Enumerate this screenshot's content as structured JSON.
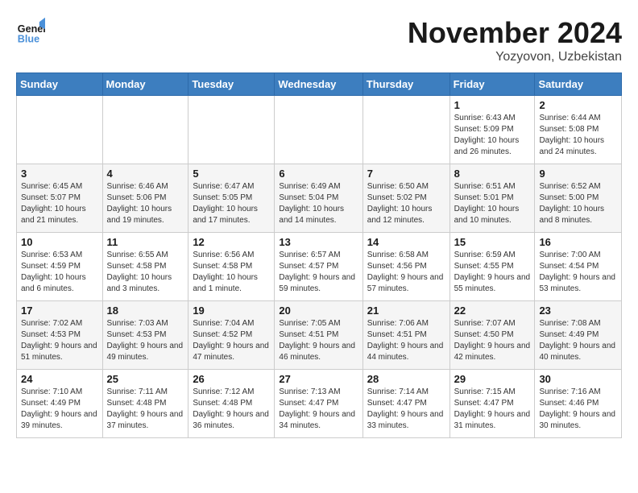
{
  "logo": {
    "line1": "General",
    "line2": "Blue"
  },
  "title": "November 2024",
  "location": "Yozyovon, Uzbekistan",
  "days_of_week": [
    "Sunday",
    "Monday",
    "Tuesday",
    "Wednesday",
    "Thursday",
    "Friday",
    "Saturday"
  ],
  "weeks": [
    [
      {
        "day": "",
        "info": ""
      },
      {
        "day": "",
        "info": ""
      },
      {
        "day": "",
        "info": ""
      },
      {
        "day": "",
        "info": ""
      },
      {
        "day": "",
        "info": ""
      },
      {
        "day": "1",
        "info": "Sunrise: 6:43 AM\nSunset: 5:09 PM\nDaylight: 10 hours and 26 minutes."
      },
      {
        "day": "2",
        "info": "Sunrise: 6:44 AM\nSunset: 5:08 PM\nDaylight: 10 hours and 24 minutes."
      }
    ],
    [
      {
        "day": "3",
        "info": "Sunrise: 6:45 AM\nSunset: 5:07 PM\nDaylight: 10 hours and 21 minutes."
      },
      {
        "day": "4",
        "info": "Sunrise: 6:46 AM\nSunset: 5:06 PM\nDaylight: 10 hours and 19 minutes."
      },
      {
        "day": "5",
        "info": "Sunrise: 6:47 AM\nSunset: 5:05 PM\nDaylight: 10 hours and 17 minutes."
      },
      {
        "day": "6",
        "info": "Sunrise: 6:49 AM\nSunset: 5:04 PM\nDaylight: 10 hours and 14 minutes."
      },
      {
        "day": "7",
        "info": "Sunrise: 6:50 AM\nSunset: 5:02 PM\nDaylight: 10 hours and 12 minutes."
      },
      {
        "day": "8",
        "info": "Sunrise: 6:51 AM\nSunset: 5:01 PM\nDaylight: 10 hours and 10 minutes."
      },
      {
        "day": "9",
        "info": "Sunrise: 6:52 AM\nSunset: 5:00 PM\nDaylight: 10 hours and 8 minutes."
      }
    ],
    [
      {
        "day": "10",
        "info": "Sunrise: 6:53 AM\nSunset: 4:59 PM\nDaylight: 10 hours and 6 minutes."
      },
      {
        "day": "11",
        "info": "Sunrise: 6:55 AM\nSunset: 4:58 PM\nDaylight: 10 hours and 3 minutes."
      },
      {
        "day": "12",
        "info": "Sunrise: 6:56 AM\nSunset: 4:58 PM\nDaylight: 10 hours and 1 minute."
      },
      {
        "day": "13",
        "info": "Sunrise: 6:57 AM\nSunset: 4:57 PM\nDaylight: 9 hours and 59 minutes."
      },
      {
        "day": "14",
        "info": "Sunrise: 6:58 AM\nSunset: 4:56 PM\nDaylight: 9 hours and 57 minutes."
      },
      {
        "day": "15",
        "info": "Sunrise: 6:59 AM\nSunset: 4:55 PM\nDaylight: 9 hours and 55 minutes."
      },
      {
        "day": "16",
        "info": "Sunrise: 7:00 AM\nSunset: 4:54 PM\nDaylight: 9 hours and 53 minutes."
      }
    ],
    [
      {
        "day": "17",
        "info": "Sunrise: 7:02 AM\nSunset: 4:53 PM\nDaylight: 9 hours and 51 minutes."
      },
      {
        "day": "18",
        "info": "Sunrise: 7:03 AM\nSunset: 4:53 PM\nDaylight: 9 hours and 49 minutes."
      },
      {
        "day": "19",
        "info": "Sunrise: 7:04 AM\nSunset: 4:52 PM\nDaylight: 9 hours and 47 minutes."
      },
      {
        "day": "20",
        "info": "Sunrise: 7:05 AM\nSunset: 4:51 PM\nDaylight: 9 hours and 46 minutes."
      },
      {
        "day": "21",
        "info": "Sunrise: 7:06 AM\nSunset: 4:51 PM\nDaylight: 9 hours and 44 minutes."
      },
      {
        "day": "22",
        "info": "Sunrise: 7:07 AM\nSunset: 4:50 PM\nDaylight: 9 hours and 42 minutes."
      },
      {
        "day": "23",
        "info": "Sunrise: 7:08 AM\nSunset: 4:49 PM\nDaylight: 9 hours and 40 minutes."
      }
    ],
    [
      {
        "day": "24",
        "info": "Sunrise: 7:10 AM\nSunset: 4:49 PM\nDaylight: 9 hours and 39 minutes."
      },
      {
        "day": "25",
        "info": "Sunrise: 7:11 AM\nSunset: 4:48 PM\nDaylight: 9 hours and 37 minutes."
      },
      {
        "day": "26",
        "info": "Sunrise: 7:12 AM\nSunset: 4:48 PM\nDaylight: 9 hours and 36 minutes."
      },
      {
        "day": "27",
        "info": "Sunrise: 7:13 AM\nSunset: 4:47 PM\nDaylight: 9 hours and 34 minutes."
      },
      {
        "day": "28",
        "info": "Sunrise: 7:14 AM\nSunset: 4:47 PM\nDaylight: 9 hours and 33 minutes."
      },
      {
        "day": "29",
        "info": "Sunrise: 7:15 AM\nSunset: 4:47 PM\nDaylight: 9 hours and 31 minutes."
      },
      {
        "day": "30",
        "info": "Sunrise: 7:16 AM\nSunset: 4:46 PM\nDaylight: 9 hours and 30 minutes."
      }
    ]
  ]
}
